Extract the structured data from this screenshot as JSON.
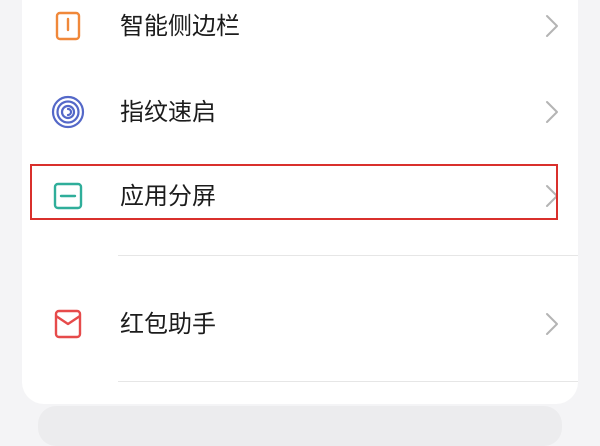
{
  "settings": {
    "items": [
      {
        "label": "智能侧边栏",
        "icon": "sidebar-icon",
        "icon_color": "#f0883a"
      },
      {
        "label": "指纹速启",
        "icon": "fingerprint-icon",
        "icon_color": "#5468c8"
      },
      {
        "label": "应用分屏",
        "icon": "split-screen-icon",
        "icon_color": "#2fae9a",
        "highlighted": true
      },
      {
        "label": "红包助手",
        "icon": "red-envelope-icon",
        "icon_color": "#e64b4b"
      }
    ]
  },
  "colors": {
    "highlight_box": "#d9302c",
    "chevron": "#b4b4b4",
    "text": "#1c1c1c"
  }
}
